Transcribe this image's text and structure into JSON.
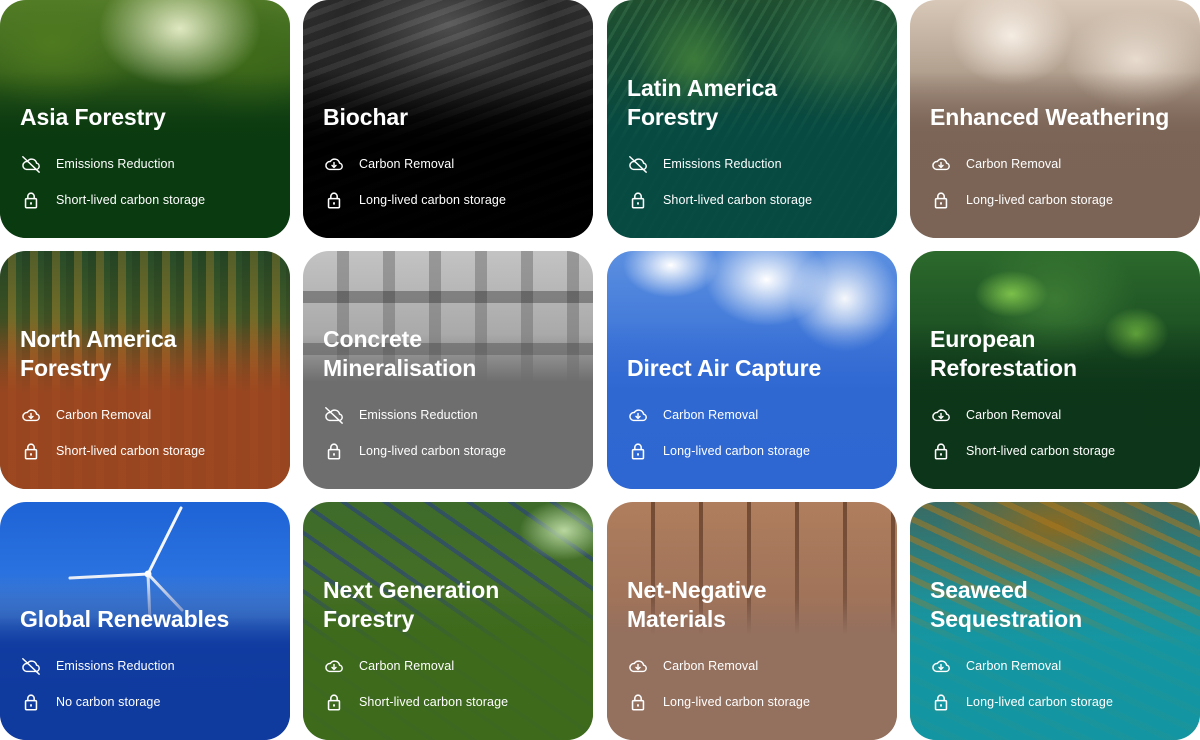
{
  "cards": [
    {
      "title": "Asia Forestry",
      "type": "Emissions Reduction",
      "storage": "Short-lived carbon storage",
      "color": "#0a3a10"
    },
    {
      "title": "Biochar",
      "type": "Carbon Removal",
      "storage": "Long-lived carbon storage",
      "color": "#000000"
    },
    {
      "title": "Latin America\nForestry",
      "type": "Emissions Reduction",
      "storage": "Short-lived carbon storage",
      "color": "#064a42"
    },
    {
      "title": "Enhanced Weathering",
      "type": "Carbon Removal",
      "storage": "Long-lived carbon storage",
      "color": "#7b6456"
    },
    {
      "title": "North America\nForestry",
      "type": "Carbon Removal",
      "storage": "Short-lived carbon storage",
      "color": "#9c4620"
    },
    {
      "title": "Concrete\nMineralisation",
      "type": "Emissions Reduction",
      "storage": "Long-lived carbon storage",
      "color": "#6e6e6e"
    },
    {
      "title": "Direct Air Capture",
      "type": "Carbon Removal",
      "storage": "Long-lived carbon storage",
      "color": "#2f67d2"
    },
    {
      "title": "European\nReforestation",
      "type": "Carbon Removal",
      "storage": "Short-lived carbon storage",
      "color": "#0d3519"
    },
    {
      "title": "Global Renewables",
      "type": "Emissions Reduction",
      "storage": "No carbon storage",
      "color": "#0f3a9e"
    },
    {
      "title": "Next Generation\nForestry",
      "type": "Carbon Removal",
      "storage": "Short-lived carbon storage",
      "color": "#3d6a1b"
    },
    {
      "title": "Net-Negative\nMaterials",
      "type": "Carbon Removal",
      "storage": "Long-lived carbon storage",
      "color": "#94705f"
    },
    {
      "title": "Seaweed\nSequestration",
      "type": "Carbon Removal",
      "storage": "Long-lived carbon storage",
      "color": "#1496a2"
    }
  ],
  "icons": {
    "emissions_reduction": "cloud-off-icon",
    "carbon_removal": "cloud-download-icon",
    "storage": "lock-icon"
  }
}
